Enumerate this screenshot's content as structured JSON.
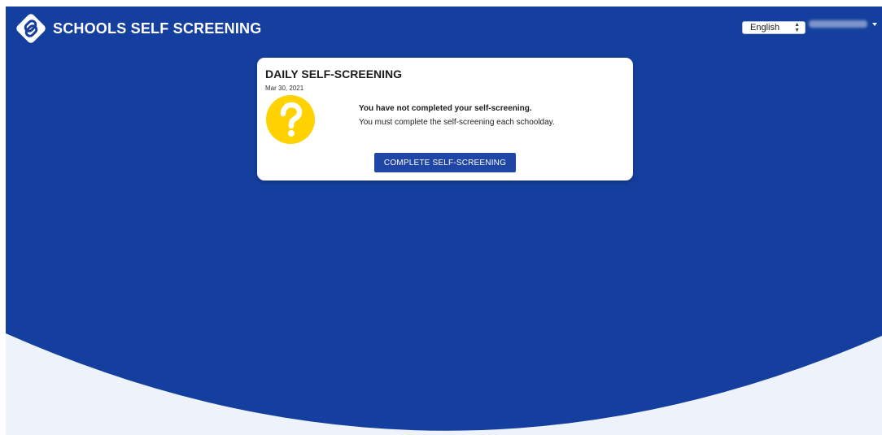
{
  "header": {
    "brand_title": "SCHOOLS SELF SCREENING",
    "logo_icon": "diamond-link-logo-icon",
    "language": {
      "selected": "English",
      "options": [
        "English"
      ]
    },
    "user_menu": {
      "name": "",
      "caret_icon": "caret-down-icon"
    }
  },
  "card": {
    "title": "DAILY SELF-SCREENING",
    "date": "Mar 30, 2021",
    "status_icon": "question-mark-icon",
    "status_heading": "You have not completed your self-screening.",
    "status_body": "You must complete the self-screening each schoolday.",
    "cta_label": "COMPLETE SELF-SCREENING"
  },
  "colors": {
    "primary_blue": "#153f9e",
    "button_blue": "#1f45a6",
    "warning_yellow": "#ffd200",
    "page_bottom": "#eef3fb"
  }
}
